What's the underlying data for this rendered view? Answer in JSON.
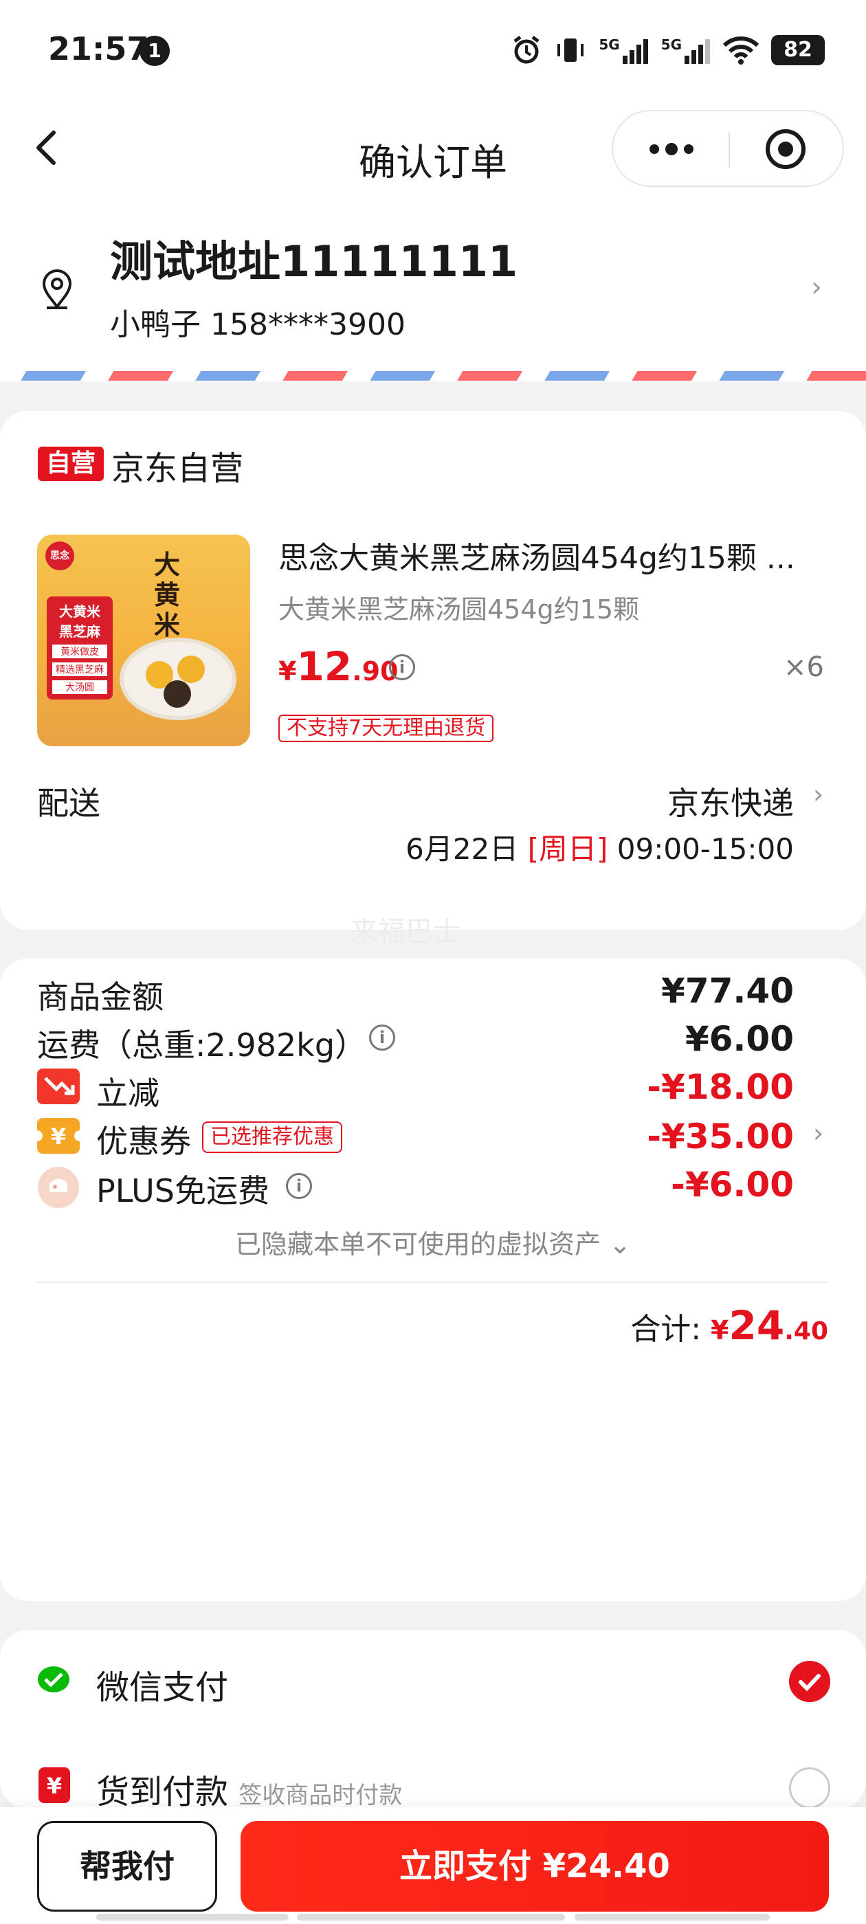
{
  "status_bar": {
    "time": "21:57",
    "notification_count": "1",
    "network_1": "5G",
    "network_2": "5G",
    "battery": "82"
  },
  "nav": {
    "title": "确认订单"
  },
  "address": {
    "title": "测试地址11111111",
    "contact": "小鸭子 158****3900"
  },
  "shop": {
    "badge": "自营",
    "name": "京东自营"
  },
  "product": {
    "title": "思念大黄米黑芝麻汤圆454g约15颗 ...",
    "subtitle": "大黄米黑芝麻汤圆454g约15颗",
    "price_symbol": "¥",
    "price_int": "12",
    "price_dec": ".90",
    "qty": "×6",
    "return_tag": "不支持7天无理由退货",
    "image_brand": "思念",
    "image_text_1": "大黄米",
    "image_text_2": "黑芝麻",
    "image_text_3": "黄米做皮",
    "image_text_4": "精选黑芝麻",
    "image_text_5": "大汤圆",
    "image_big_text": "大黄米"
  },
  "delivery": {
    "label": "配送",
    "carrier": "京东快递",
    "date": "6月22日 ",
    "weekday": "[周日]",
    "time": " 09:00-15:00"
  },
  "watermark": "来福巴士",
  "summary": {
    "goods_label": "商品金额",
    "goods_value": "¥77.40",
    "freight_label": "运费（总重:2.982kg）",
    "freight_value": "¥6.00",
    "discount_label": "立减",
    "discount_value": "-¥18.00",
    "coupon_label": "优惠券",
    "coupon_tag": "已选推荐优惠",
    "coupon_value": "-¥35.00",
    "plus_label": "PLUS免运费",
    "plus_value": "-¥6.00",
    "hidden_note": "已隐藏本单不可使用的虚拟资产",
    "total_label": "合计:",
    "total_symbol": "¥",
    "total_int": "24",
    "total_dec": ".40"
  },
  "payment": {
    "wechat_label": "微信支付",
    "cod_label": "货到付款",
    "cod_sub": "签收商品时付款"
  },
  "bottom": {
    "help_label": "帮我付",
    "pay_label": "立即支付 ¥24.40"
  },
  "colors": {
    "accent": "#e4141e",
    "wechat": "#09bb07",
    "coupon": "#f5a623"
  }
}
